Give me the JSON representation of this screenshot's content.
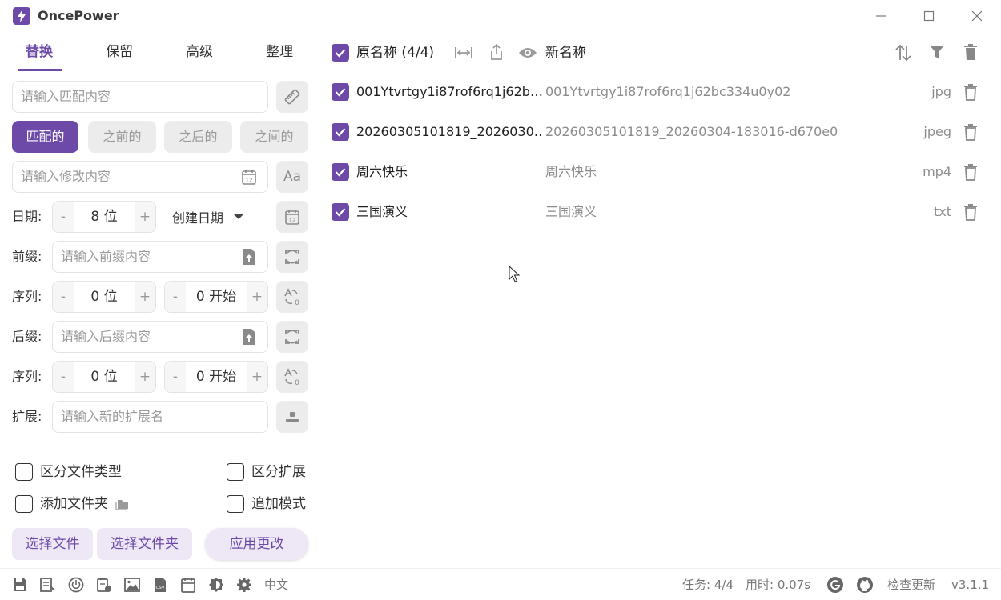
{
  "window": {
    "app_title": "OncePower"
  },
  "tabs": [
    {
      "label": "替换",
      "active": true
    },
    {
      "label": "保留"
    },
    {
      "label": "高级"
    },
    {
      "label": "整理"
    }
  ],
  "match": {
    "placeholder": "请输入匹配内容"
  },
  "modes": [
    "匹配的",
    "之前的",
    "之后的",
    "之间的"
  ],
  "modify": {
    "placeholder": "请输入修改内容"
  },
  "date_row": {
    "label": "日期:",
    "digits": "8 位",
    "minus": "-",
    "plus": "+",
    "select_value": "创建日期"
  },
  "prefix_row": {
    "label": "前缀:",
    "placeholder": "请输入前缀内容"
  },
  "seq1": {
    "label": "序列:",
    "digits": "0 位",
    "start": "0 开始",
    "minus": "-",
    "plus": "+"
  },
  "suffix_row": {
    "label": "后缀:",
    "placeholder": "请输入后缀内容"
  },
  "seq2": {
    "label": "序列:",
    "digits": "0 位",
    "start": "0 开始",
    "minus": "-",
    "plus": "+"
  },
  "ext_row": {
    "label": "扩展:",
    "placeholder": "请输入新的扩展名"
  },
  "options": {
    "distinguish_type": "区分文件类型",
    "distinguish_ext": "区分扩展",
    "add_folder": "添加文件夹",
    "append_mode": "追加模式"
  },
  "actions": {
    "select_files": "选择文件",
    "select_folder": "选择文件夹",
    "apply": "应用更改"
  },
  "list_header": {
    "original": "原名称 (4/4)",
    "new": "新名称"
  },
  "files": [
    {
      "original": "001Ytvrtgy1i87rof6rq1j62b…",
      "new": "001Ytvrtgy1i87rof6rq1j62bc334u0y02",
      "ext": "jpg"
    },
    {
      "original": "20260305101819_2026030…",
      "new": "20260305101819_20260304-183016-d670e0",
      "ext": "jpeg"
    },
    {
      "original": "周六快乐",
      "new": "周六快乐",
      "ext": "mp4"
    },
    {
      "original": "三国演义",
      "new": "三国演义",
      "ext": "txt"
    }
  ],
  "status": {
    "language": "中文",
    "tasks": "任务: 4/4",
    "time": "用时: 0.07s",
    "check_update": "检查更新",
    "version": "v3.1.1"
  },
  "colors": {
    "accent": "#6d4aa8",
    "accent_light": "#ede7f6"
  },
  "icons": [
    "logo-icon",
    "minimize-icon",
    "maximize-icon",
    "close-icon",
    "ruler-icon",
    "calendar-icon",
    "font-case-icon",
    "dropdown-icon",
    "upload-file-icon",
    "refresh-icon",
    "sort-number-icon",
    "insert-icon",
    "folder-icon",
    "fit-width-icon",
    "share-icon",
    "eye-icon",
    "sort-icon",
    "filter-icon",
    "trash-icon",
    "save-icon",
    "list-icon",
    "power-icon",
    "clipboard-icon",
    "image-icon",
    "csv-icon",
    "calendar-small-icon",
    "theme-icon",
    "gear-icon",
    "g-logo-icon",
    "github-icon"
  ]
}
